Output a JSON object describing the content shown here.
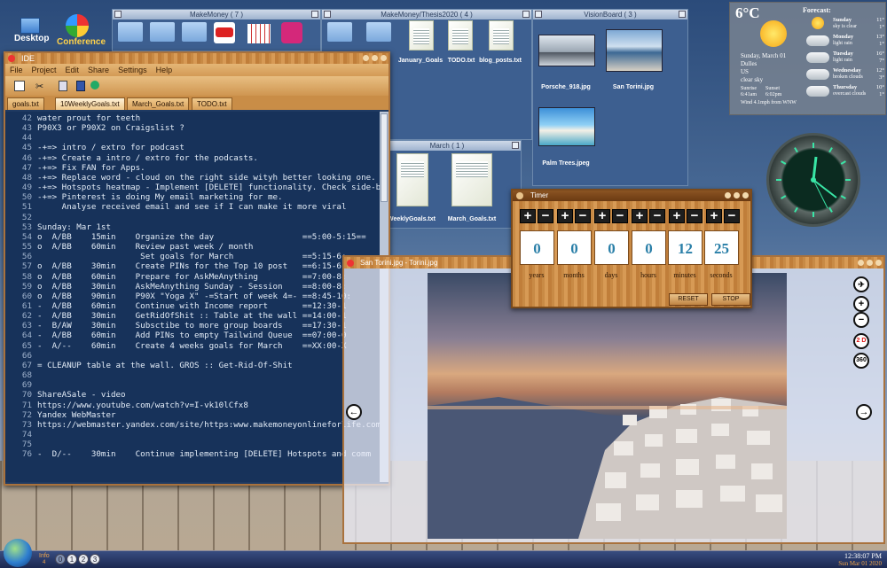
{
  "desktop": {
    "icons": [
      {
        "label": "Desktop",
        "icon": "desktop-folder-icon"
      },
      {
        "label": "Conference",
        "icon": "conference-icon"
      }
    ]
  },
  "windows": {
    "makemoney": {
      "title": "MakeMoney ( 7 )"
    },
    "makemoney_thesis": {
      "title": "MakeMoney/Thesis2020 ( 4 )",
      "files": [
        "January_Goals",
        "TODO.txt",
        "blog_posts.txt"
      ]
    },
    "visionboard": {
      "title": "VisionBoard ( 3 )",
      "files": [
        "Porsche_918.jpg",
        "San Torini.jpg",
        "Palm Trees.jpeg"
      ]
    },
    "march": {
      "title": "March ( 1 )",
      "files": [
        "WeeklyGoals.txt",
        "March_Goals.txt"
      ]
    }
  },
  "ide": {
    "title": "IDE",
    "menu": [
      "File",
      "Project",
      "Edit",
      "Share",
      "Settings",
      "Help"
    ],
    "tabs": [
      "goals.txt",
      "10WeeklyGoals.txt",
      "March_Goals.txt",
      "TODO.txt"
    ],
    "active_tab": "10WeeklyGoals.txt",
    "lines": [
      {
        "n": "42",
        "t": "water prout for teeth"
      },
      {
        "n": "43",
        "t": "P90X3 or P90X2 on Craigslist ?"
      },
      {
        "n": "44",
        "t": ""
      },
      {
        "n": "45",
        "t": "-+=> intro / extro for podcast"
      },
      {
        "n": "46",
        "t": "-+=> Create a intro / extro for the podcasts."
      },
      {
        "n": "47",
        "t": "-+=> Fix FAN for Apps."
      },
      {
        "n": "48",
        "t": "-+=> Replace word - cloud on the right side wityh better looking one."
      },
      {
        "n": "49",
        "t": "-+=> Hotspots heatmap - Implement [DELETE] functionality. Check side-ba"
      },
      {
        "n": "50",
        "t": "-+=> Pinterest is doing My email marketing for me."
      },
      {
        "n": "51",
        "t": "     Analyse received email and see if I can make it more viral"
      },
      {
        "n": "52",
        "t": ""
      },
      {
        "n": "53",
        "t": "Sunday: Mar 1st"
      },
      {
        "n": "54",
        "t": "o  A/BB    15min    Organize the day                  ==5:00-5:15=="
      },
      {
        "n": "55",
        "t": "o  A/BB    60min    Review past week / month"
      },
      {
        "n": "56",
        "t": "                     Set goals for March              ==5:15-6:"
      },
      {
        "n": "57",
        "t": "o  A/BB    30min    Create PINs for the Top 10 post   ==6:15-6:"
      },
      {
        "n": "58",
        "t": "o  A/BB    60min    Prepare for AskMeAnything         ==7:00-8:"
      },
      {
        "n": "59",
        "t": "o  A/BB    30min    AskMeAnything Sunday - Session    ==8:00-8:"
      },
      {
        "n": "60",
        "t": "o  A/BB    90min    P90X \"Yoga X\" -=Start of week 4=- ==8:45-10:"
      },
      {
        "n": "61",
        "t": "-  A/BB    60min    Continue with Income report       ==12:30-1"
      },
      {
        "n": "62",
        "t": "-  A/BB    30min    GetRidOfShit :: Table at the wall ==14:00-1"
      },
      {
        "n": "63",
        "t": "-  B/AW    30min    Subsctibe to more group boards    ==17:30-1"
      },
      {
        "n": "64",
        "t": "-  A/BB    60min    Add PINs to empty Tailwind Queue  ==07:00-0"
      },
      {
        "n": "65",
        "t": "-  A/--    60min    Create 4 weeks goals for March    ==XX:00-X"
      },
      {
        "n": "66",
        "t": ""
      },
      {
        "n": "67",
        "t": "= CLEANUP table at the wall. GROS :: Get-Rid-Of-Shit"
      },
      {
        "n": "68",
        "t": ""
      },
      {
        "n": "69",
        "t": ""
      },
      {
        "n": "70",
        "t": "ShareASale - video"
      },
      {
        "n": "71",
        "t": "https://www.youtube.com/watch?v=I-vk10lCfx8"
      },
      {
        "n": "72",
        "t": "Yandex WebMaster"
      },
      {
        "n": "73",
        "t": "https://webmaster.yandex.com/site/https:www.makemoneyonlineforlife.com"
      },
      {
        "n": "74",
        "t": ""
      },
      {
        "n": "75",
        "t": ""
      },
      {
        "n": "76",
        "t": "-  D/--    30min    Continue implementing [DELETE] Hotspots and comm"
      }
    ]
  },
  "viewer": {
    "title": "San Torini.jpg - Torini.jpg",
    "tools": [
      "zoom-fit",
      "+",
      "−",
      "2 D",
      "360"
    ],
    "prev": "←",
    "next": "→"
  },
  "timer": {
    "title": "Timer",
    "fields": [
      {
        "label": "years",
        "value": "0"
      },
      {
        "label": "months",
        "value": "0"
      },
      {
        "label": "days",
        "value": "0"
      },
      {
        "label": "hours",
        "value": "0"
      },
      {
        "label": "minutes",
        "value": "12"
      },
      {
        "label": "seconds",
        "value": "25"
      }
    ],
    "reset_label": "RESET",
    "stop_label": "STOP"
  },
  "weather": {
    "temp": "6°C",
    "forecast_label": "Forecast:",
    "date": "Sunday, March 01",
    "city": "Dulles",
    "country": "US",
    "condition": "clear sky",
    "sunrise_label": "Sunrise",
    "sunset_label": "Sunset",
    "sunrise": "6:41am",
    "sunset": "6:02pm",
    "wind": "Wind 4.1mph from WNW",
    "days": [
      {
        "day": "Sunday",
        "desc": "sky is clear",
        "hi": "11°",
        "lo": "1°",
        "icon": "sun-icon"
      },
      {
        "day": "Monday",
        "desc": "light rain",
        "hi": "13°",
        "lo": "1°",
        "icon": "rain-cloud-icon"
      },
      {
        "day": "Tuesday",
        "desc": "light rain",
        "hi": "16°",
        "lo": "7°",
        "icon": "rain-cloud-icon"
      },
      {
        "day": "Wednesday",
        "desc": "broken clouds",
        "hi": "12°",
        "lo": "3°",
        "icon": "sun-cloud-icon"
      },
      {
        "day": "Thursday",
        "desc": "overcast clouds",
        "hi": "10°",
        "lo": "1°",
        "icon": "cloud-icon"
      }
    ]
  },
  "taskbar": {
    "info": "Info",
    "info_num": "4",
    "desktops": [
      "0",
      "1",
      "2",
      "3"
    ],
    "time": "12:38:07 PM",
    "date": "Sun Mar 01 2020"
  }
}
